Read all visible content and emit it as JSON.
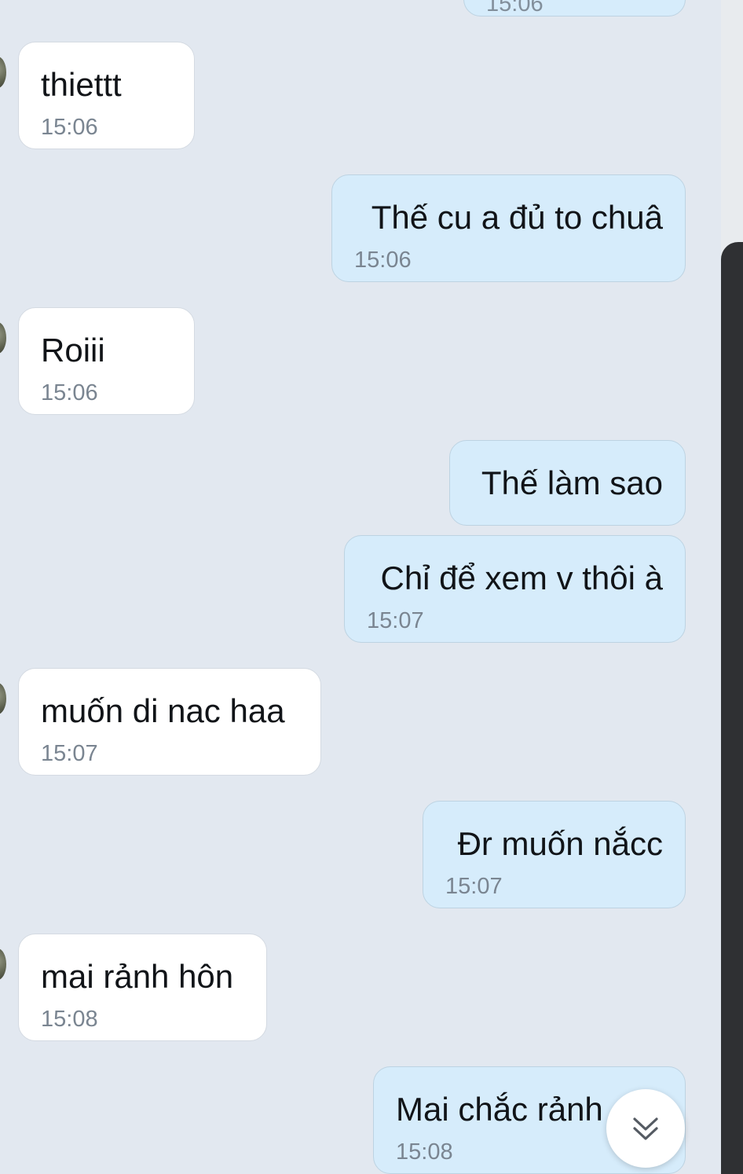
{
  "messages": [
    {
      "direction": "out",
      "text": "",
      "time": "15:06"
    },
    {
      "direction": "in",
      "text": "thiettt",
      "time": "15:06"
    },
    {
      "direction": "out",
      "text": "Thế cu a đủ to chuâ",
      "time": "15:06"
    },
    {
      "direction": "in",
      "text": "Roiii",
      "time": "15:06"
    },
    {
      "direction": "out",
      "text": "Thế làm sao",
      "time": ""
    },
    {
      "direction": "out",
      "text": "Chỉ để xem v thôi à",
      "time": "15:07"
    },
    {
      "direction": "in",
      "text": "muốn di nac haa",
      "time": "15:07"
    },
    {
      "direction": "out",
      "text": "Đr muốn nắcc",
      "time": "15:07"
    },
    {
      "direction": "in",
      "text": "mai rảnh hôn",
      "time": "15:08"
    },
    {
      "direction": "out",
      "text": "Mai chắc rảnh",
      "time": "15:08"
    }
  ],
  "icons": {
    "scroll_down": "double-chevron-down-icon",
    "avatar": "contact-avatar"
  },
  "colors": {
    "background": "#e2e8f0",
    "incoming_bubble": "#ffffff",
    "outgoing_bubble": "#d6ecfb",
    "text": "#111418",
    "timestamp": "#7a8591"
  }
}
